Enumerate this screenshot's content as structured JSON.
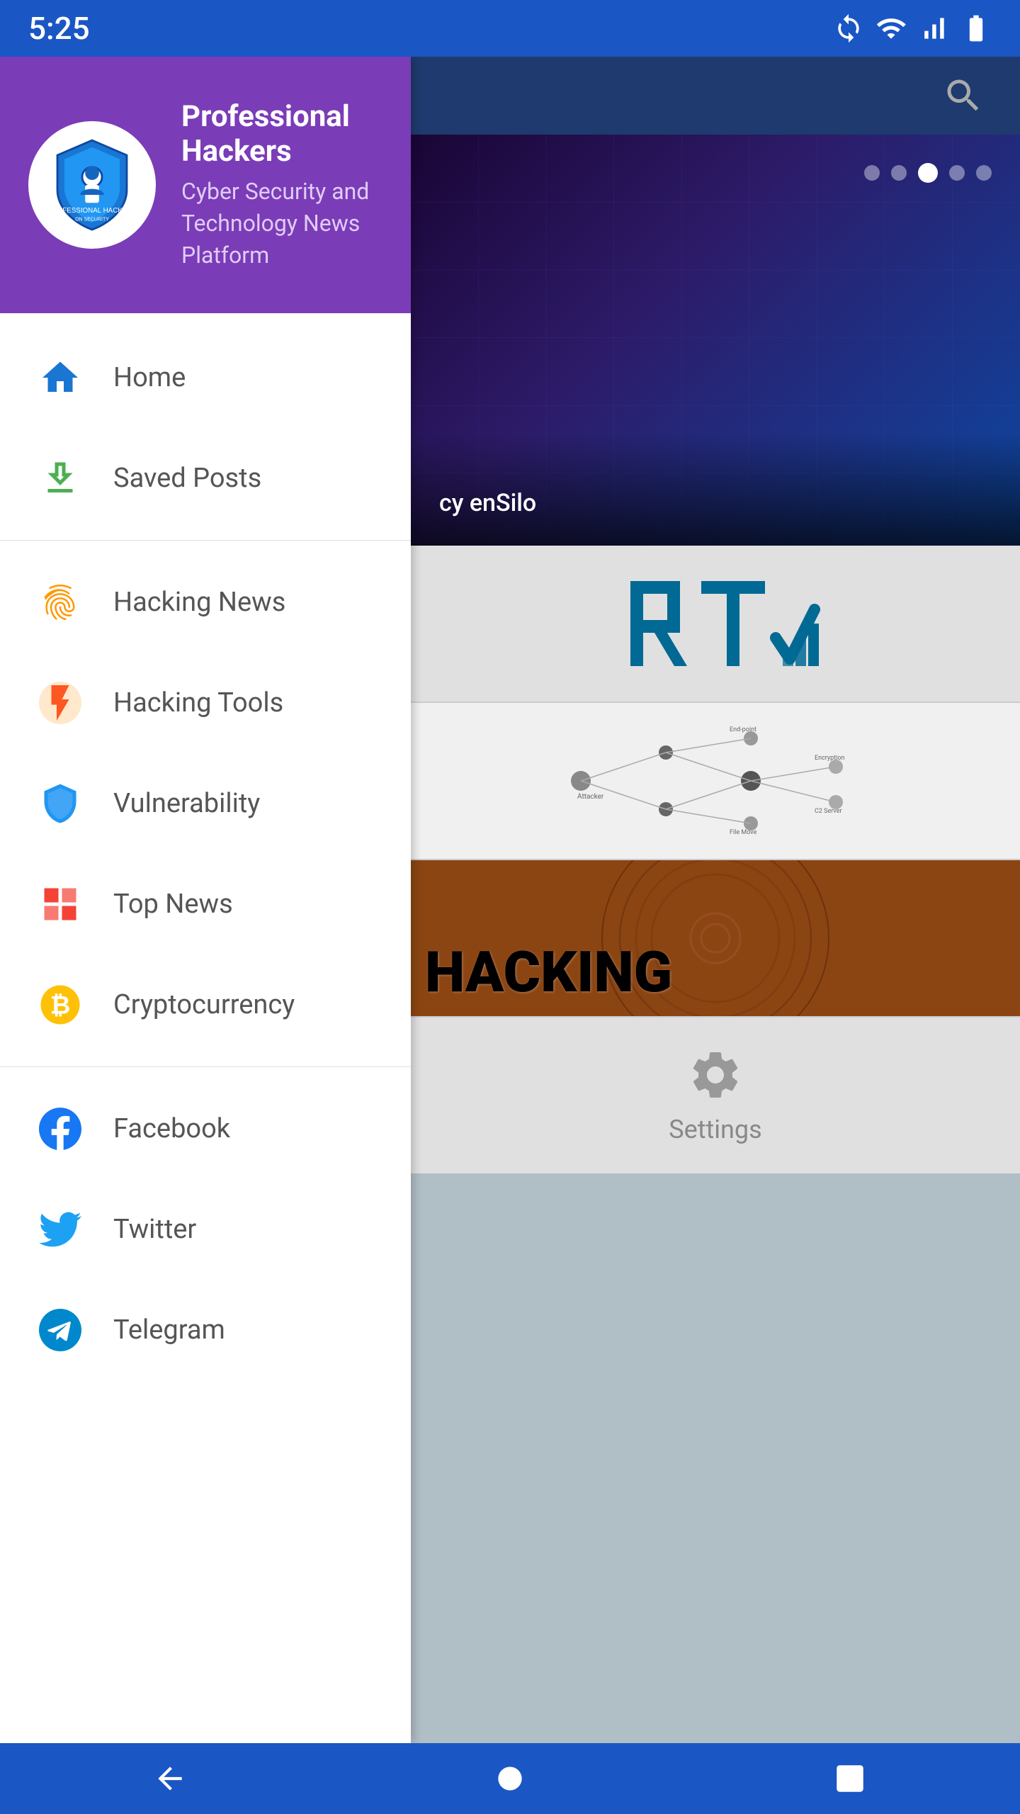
{
  "statusBar": {
    "time": "5:25",
    "icons": [
      "sync-icon",
      "wifi-icon",
      "signal-icon",
      "battery-icon"
    ]
  },
  "sidebar": {
    "appName": "Professional Hackers",
    "appDesc": "Cyber Security and Technology News Platform",
    "menuItems": [
      {
        "id": "home",
        "label": "Home",
        "iconType": "home",
        "section": "main"
      },
      {
        "id": "saved",
        "label": "Saved Posts",
        "iconType": "save",
        "section": "main"
      },
      {
        "id": "hacking-news",
        "label": "Hacking News",
        "iconType": "fingerprint",
        "section": "categories"
      },
      {
        "id": "hacking-tools",
        "label": "Hacking Tools",
        "iconType": "lightning",
        "section": "categories"
      },
      {
        "id": "vulnerability",
        "label": "Vulnerability",
        "iconType": "shield",
        "section": "categories"
      },
      {
        "id": "top-news",
        "label": "Top News",
        "iconType": "grid",
        "section": "categories"
      },
      {
        "id": "cryptocurrency",
        "label": "Cryptocurrency",
        "iconType": "bitcoin",
        "section": "categories"
      },
      {
        "id": "facebook",
        "label": "Facebook",
        "iconType": "facebook",
        "section": "social"
      },
      {
        "id": "twitter",
        "label": "Twitter",
        "iconType": "twitter",
        "section": "social"
      },
      {
        "id": "telegram",
        "label": "Telegram",
        "iconType": "telegram",
        "section": "social"
      }
    ]
  },
  "rightPanel": {
    "heroCaptions": [
      "cy enSilo"
    ],
    "heroDots": [
      false,
      false,
      true,
      false,
      false
    ],
    "cards": [
      {
        "type": "rt-logo",
        "label": "RT Logo Card"
      },
      {
        "type": "network-diagram",
        "label": "Network Diagram Card"
      },
      {
        "type": "hacking",
        "label": "HACKING",
        "text": "HACKING"
      },
      {
        "type": "settings",
        "label": "Settings",
        "text": "Settings"
      }
    ]
  },
  "bottomNav": {
    "back": "◀",
    "home": "●",
    "recent": "■"
  }
}
